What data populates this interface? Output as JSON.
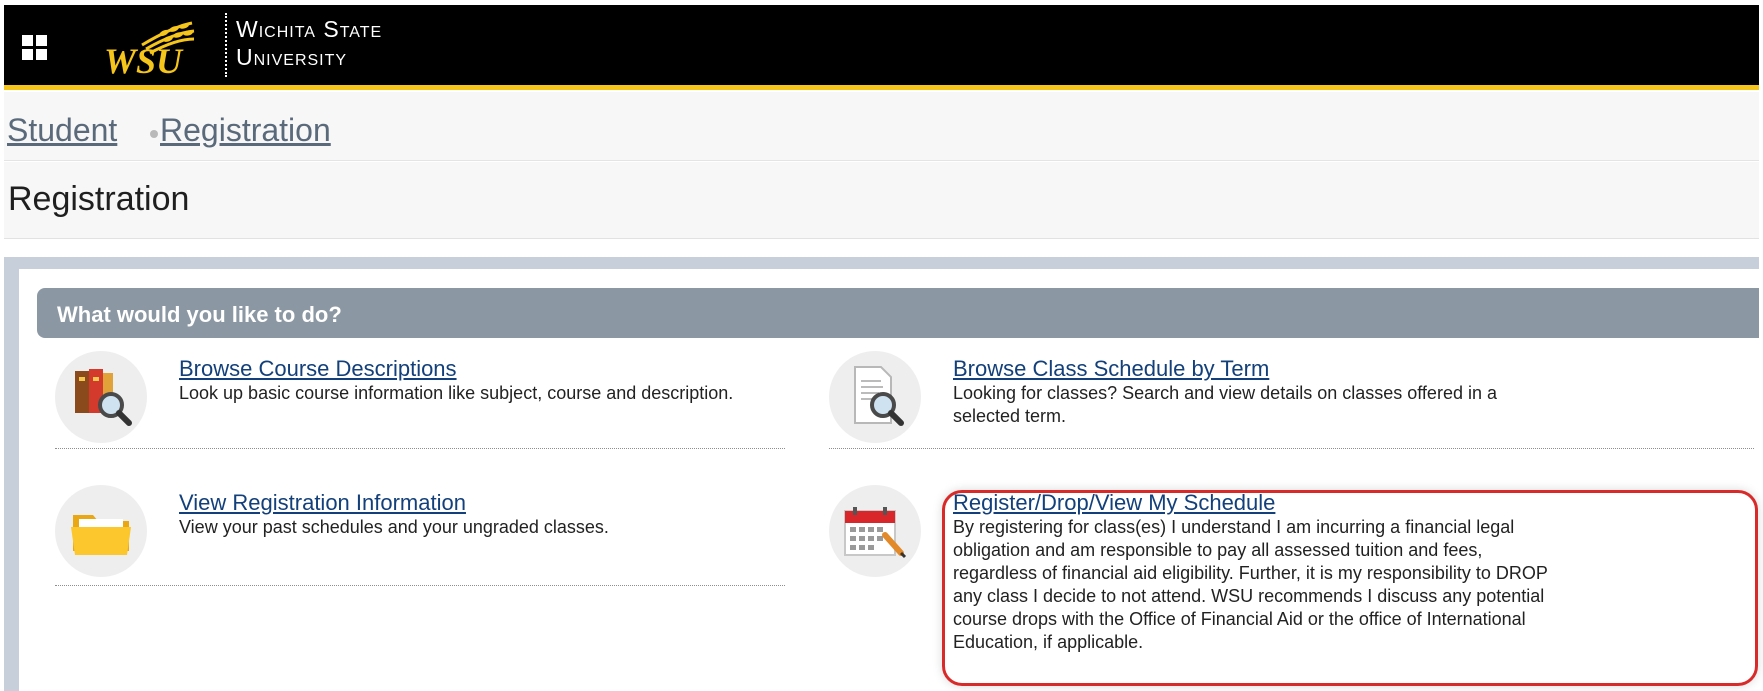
{
  "header": {
    "logo_text_line1": "Wichita State",
    "logo_text_line2": "University",
    "logo_monogram": "WSU",
    "apps_icon": "grid-apps-icon",
    "accent_color": "#f5c51b"
  },
  "breadcrumb": {
    "items": [
      "Student",
      "Registration"
    ]
  },
  "page": {
    "title": "Registration"
  },
  "panel": {
    "header": "What would you like to do?",
    "header_color": "#8b98a3",
    "options": [
      {
        "title": "Browse Course Descriptions",
        "description": "Look up basic course information like subject, course and description.",
        "icon": "book-search-icon"
      },
      {
        "title": "Browse Class Schedule by Term",
        "description": "Looking for classes? Search and view details on classes offered in a selected term.",
        "icon": "document-search-icon"
      },
      {
        "title": "View Registration Information",
        "description": "View your past schedules and your ungraded classes.",
        "icon": "folder-icon"
      },
      {
        "title": "Register/Drop/View My Schedule",
        "description": "By registering for class(es) I understand I am incurring a financial legal obligation and am responsible to pay all assessed tuition and fees, regardless of financial aid eligibility. Further, it is my responsibility to DROP any class I decide to not attend. WSU recommends I discuss any potential course drops with the Office of Financial Aid or the office of International Education, if applicable.",
        "icon": "calendar-edit-icon"
      }
    ],
    "highlight_color": "#d92a2a"
  }
}
